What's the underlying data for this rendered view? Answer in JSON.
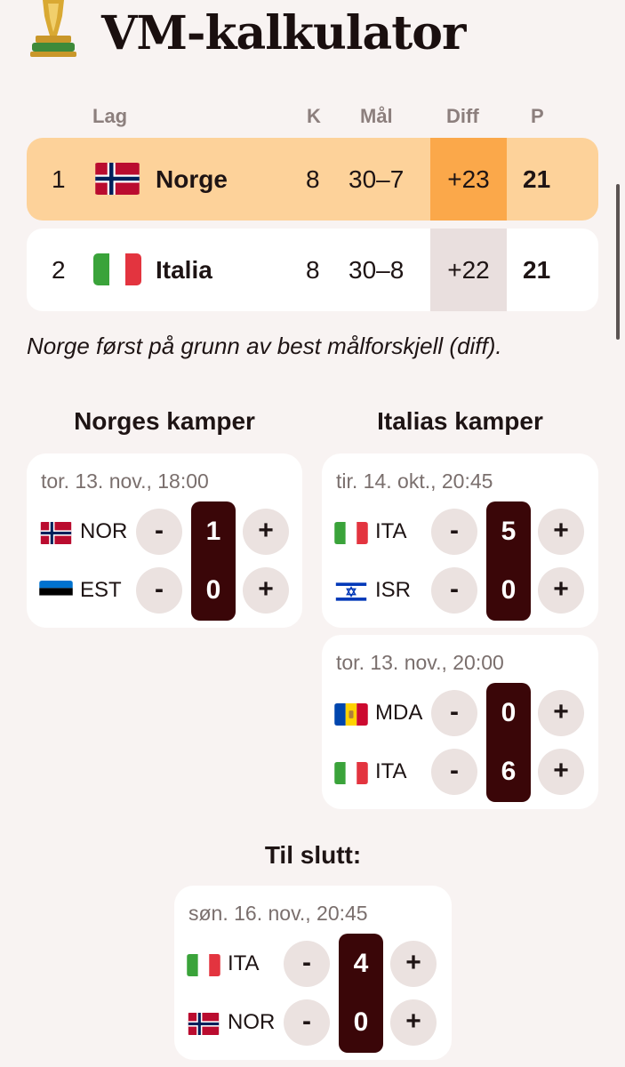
{
  "header": {
    "title": "VM-kalkulator",
    "logo": "trophy-icon"
  },
  "standings": {
    "columns": {
      "team": "Lag",
      "matches": "K",
      "goals": "Mål",
      "diff": "Diff",
      "points": "P"
    },
    "rows": [
      {
        "rank": "1",
        "team": "Norge",
        "flag": "norway",
        "matches": "8",
        "goals": "30–7",
        "diff": "+23",
        "points": "21"
      },
      {
        "rank": "2",
        "team": "Italia",
        "flag": "italy",
        "matches": "8",
        "goals": "30–8",
        "diff": "+22",
        "points": "21"
      }
    ],
    "note": "Norge først på grunn av best målforskjell (diff)."
  },
  "norway_matches": {
    "title": "Norges kamper",
    "matches": [
      {
        "date": "tor. 13. nov., 18:00",
        "home": "NOR",
        "home_score": "1",
        "away": "EST",
        "away_score": "0"
      }
    ]
  },
  "italy_matches": {
    "title": "Italias kamper",
    "matches": [
      {
        "date": "tir. 14. okt., 20:45",
        "home": "ITA",
        "home_score": "5",
        "away": "ISR",
        "away_score": "0"
      },
      {
        "date": "tor. 13. nov., 20:00",
        "home": "MDA",
        "home_score": "0",
        "away": "ITA",
        "away_score": "6"
      }
    ]
  },
  "final_match": {
    "title": "Til slutt:",
    "date": "søn. 16. nov., 20:45",
    "home": "ITA",
    "home_score": "4",
    "away": "NOR",
    "away_score": "0"
  },
  "buttons": {
    "minus": "-",
    "plus": "+"
  },
  "colors": {
    "background": "#f8f3f2",
    "leader_row": "#fdd29a",
    "leader_diff": "#fba84a",
    "score_box": "#3a0608",
    "button": "#ebe2e0"
  }
}
